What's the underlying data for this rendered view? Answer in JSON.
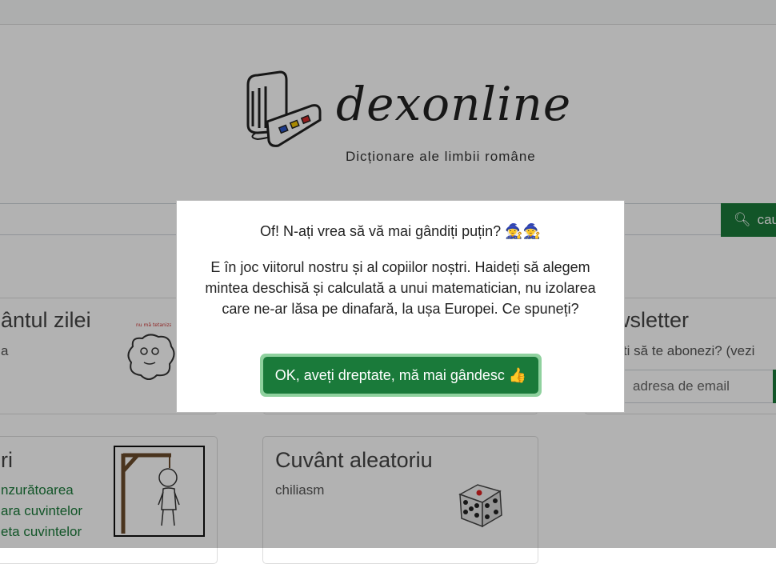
{
  "header": {
    "logo_text": "dexonline",
    "tagline": "Dicționare ale limbii române"
  },
  "search": {
    "button_label": "cau",
    "button_icon": "search-icon"
  },
  "cards": {
    "word_of_day": {
      "title": "ântul zilei",
      "text": "a",
      "image_caption": "nu mă tetanizați"
    },
    "newsletter": {
      "title": "wsletter",
      "text": "ești să te abonezi? (vezi",
      "email_placeholder": "adresa de email"
    },
    "games": {
      "title": "ri",
      "links": [
        "nzurătoarea",
        "ara cuvintelor",
        "eta cuvintelor"
      ]
    },
    "random_word": {
      "title": "Cuvânt aleatoriu",
      "text": "chiliasm"
    }
  },
  "modal": {
    "question": "Of! N-ați vrea să vă mai gândiți puțin? 🧙‍♀️🧙",
    "body": "E în joc viitorul nostru și al copiilor noștri. Haideți să alegem mintea deschisă și calculată a unui matematician, nu izolarea care ne-ar lăsa pe dinafară, la ușa Europei. Ce spuneți?",
    "ok_label": "OK, aveți dreptate, mă mai gândesc 👍"
  },
  "colors": {
    "accent": "#1a7a3a",
    "button_ring": "#8fd19e",
    "overlay": "rgba(0,0,0,0.30)"
  }
}
